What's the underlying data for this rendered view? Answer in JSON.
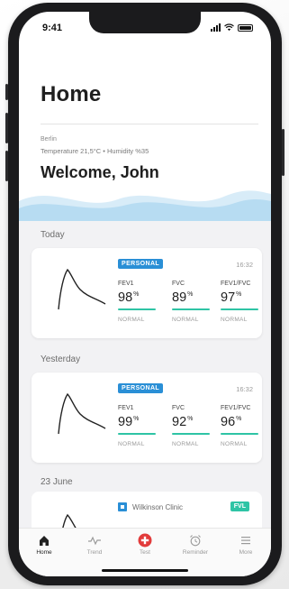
{
  "status_bar": {
    "time": "9:41"
  },
  "header": {
    "title": "Home"
  },
  "weather": {
    "city": "Berlin",
    "line": "Temperature 21,5°C • Humidity %35"
  },
  "welcome": "Welcome, John",
  "sections": [
    {
      "label": "Today"
    },
    {
      "label": "Yesterday"
    },
    {
      "label": "23 June"
    }
  ],
  "cards": [
    {
      "badge": "PERSONAL",
      "time": "16:32",
      "metrics": [
        {
          "label": "FEV1",
          "value": "98",
          "unit": "%",
          "status": "NORMAL"
        },
        {
          "label": "FVC",
          "value": "89",
          "unit": "%",
          "status": "NORMAL"
        },
        {
          "label": "FEV1/FVC",
          "value": "97",
          "unit": "%",
          "status": "NORMAL"
        }
      ]
    },
    {
      "badge": "PERSONAL",
      "time": "16:32",
      "metrics": [
        {
          "label": "FEV1",
          "value": "99",
          "unit": "%",
          "status": "NORMAL"
        },
        {
          "label": "FVC",
          "value": "92",
          "unit": "%",
          "status": "NORMAL"
        },
        {
          "label": "FEV1/FVC",
          "value": "96",
          "unit": "%",
          "status": "NORMAL"
        }
      ]
    }
  ],
  "clinic_card": {
    "name": "Wilkinson Clinic",
    "badge": "FVL"
  },
  "tabs": [
    {
      "label": "Home",
      "icon": "home-icon",
      "active": true
    },
    {
      "label": "Trend",
      "icon": "trend-icon"
    },
    {
      "label": "Test",
      "icon": "test-plus-icon"
    },
    {
      "label": "Reminder",
      "icon": "alarm-clock-icon"
    },
    {
      "label": "More",
      "icon": "menu-icon"
    }
  ],
  "colors": {
    "badge_blue": "#2a8fd6",
    "normal_green": "#2ec4a5",
    "test_red": "#e23b3b",
    "wave_light": "#d8ecf8",
    "wave_mid": "#b7dcf2"
  }
}
